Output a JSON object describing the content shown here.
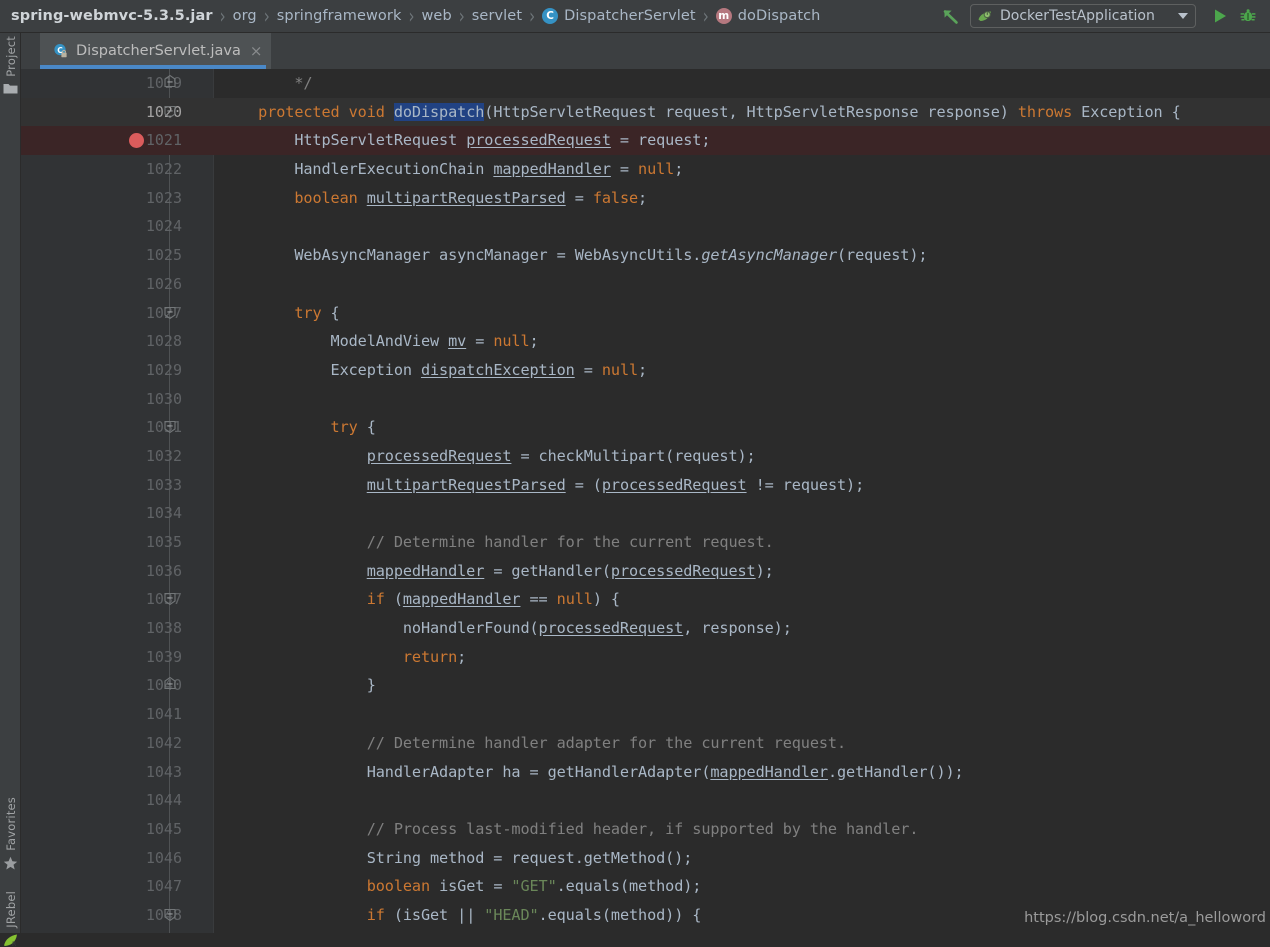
{
  "window": {
    "accent_blue": "#4a88c7",
    "editor_bg": "#2b2b2b",
    "gutter_bg": "#313335",
    "chrome_bg": "#3c3f41",
    "breakpoint_color": "#db5c5c",
    "selection_color": "#214283",
    "current_line_bg": "#323232",
    "breakpoint_line_bg": "#3b2526"
  },
  "breadcrumb": {
    "items": [
      {
        "label": "spring-webmvc-5.3.5.jar",
        "icon": "",
        "bold": true
      },
      {
        "label": "org",
        "icon": ""
      },
      {
        "label": "springframework",
        "icon": ""
      },
      {
        "label": "web",
        "icon": ""
      },
      {
        "label": "servlet",
        "icon": ""
      },
      {
        "label": "DispatcherServlet",
        "icon": "class-icon",
        "icon_glyph": "C"
      },
      {
        "label": "doDispatch",
        "icon": "method-icon",
        "icon_glyph": "m"
      }
    ],
    "separator": "›"
  },
  "toolbar": {
    "back_arrow_icon": "back-arrow-icon",
    "run_configuration": "DockerTestApplication",
    "run_config_icon": "spring-boot-leaf-icon",
    "dropdown_caret": "chevron-down-icon",
    "run_button_icon": "run-play-icon",
    "debug_button_icon": "debug-bug-icon"
  },
  "tool_stripe": {
    "top_items": [
      {
        "label": "Project",
        "icon": "project-folder-icon"
      }
    ],
    "bottom_items": [
      {
        "label": "Favorites",
        "icon": "star-icon"
      },
      {
        "label": "JRebel",
        "icon": "jrebel-leaf-icon"
      }
    ]
  },
  "tab": {
    "label": "DispatcherServlet.java",
    "icon": "java-class-readonly-icon",
    "close_icon": "×",
    "active": true
  },
  "editor": {
    "first_line": 1019,
    "current_line": 1020,
    "breakpoint_line": 1021,
    "selected_text": "doDispatch",
    "lines": [
      {
        "n": 1019,
        "fold": "up"
      },
      {
        "n": 1020,
        "fold": "down",
        "current": true
      },
      {
        "n": 1021,
        "breakpoint": true
      },
      {
        "n": 1022
      },
      {
        "n": 1023
      },
      {
        "n": 1024
      },
      {
        "n": 1025
      },
      {
        "n": 1026
      },
      {
        "n": 1027,
        "fold": "down"
      },
      {
        "n": 1028
      },
      {
        "n": 1029
      },
      {
        "n": 1030
      },
      {
        "n": 1031,
        "fold": "down"
      },
      {
        "n": 1032
      },
      {
        "n": 1033
      },
      {
        "n": 1034
      },
      {
        "n": 1035
      },
      {
        "n": 1036
      },
      {
        "n": 1037,
        "fold": "down"
      },
      {
        "n": 1038
      },
      {
        "n": 1039
      },
      {
        "n": 1040,
        "fold": "up"
      },
      {
        "n": 1041
      },
      {
        "n": 1042
      },
      {
        "n": 1043
      },
      {
        "n": 1044
      },
      {
        "n": 1045
      },
      {
        "n": 1046
      },
      {
        "n": 1047
      },
      {
        "n": 1048,
        "fold": "down"
      }
    ],
    "source_text": [
      "*/",
      "protected void doDispatch(HttpServletRequest request, HttpServletResponse response) throws Exception {",
      "    HttpServletRequest processedRequest = request;",
      "    HandlerExecutionChain mappedHandler = null;",
      "    boolean multipartRequestParsed = false;",
      "",
      "    WebAsyncManager asyncManager = WebAsyncUtils.getAsyncManager(request);",
      "",
      "    try {",
      "        ModelAndView mv = null;",
      "        Exception dispatchException = null;",
      "",
      "        try {",
      "            processedRequest = checkMultipart(request);",
      "            multipartRequestParsed = (processedRequest != request);",
      "",
      "            // Determine handler for the current request.",
      "            mappedHandler = getHandler(processedRequest);",
      "            if (mappedHandler == null) {",
      "                noHandlerFound(processedRequest, response);",
      "                return;",
      "            }",
      "",
      "            // Determine handler adapter for the current request.",
      "            HandlerAdapter ha = getHandlerAdapter(mappedHandler.getHandler());",
      "",
      "            // Process last-modified header, if supported by the handler.",
      "            String method = request.getMethod();",
      "            boolean isGet = \"GET\".equals(method);",
      "            if (isGet || \"HEAD\".equals(method)) {"
    ]
  },
  "watermark": {
    "text": "https://blog.csdn.net/a_helloword"
  }
}
